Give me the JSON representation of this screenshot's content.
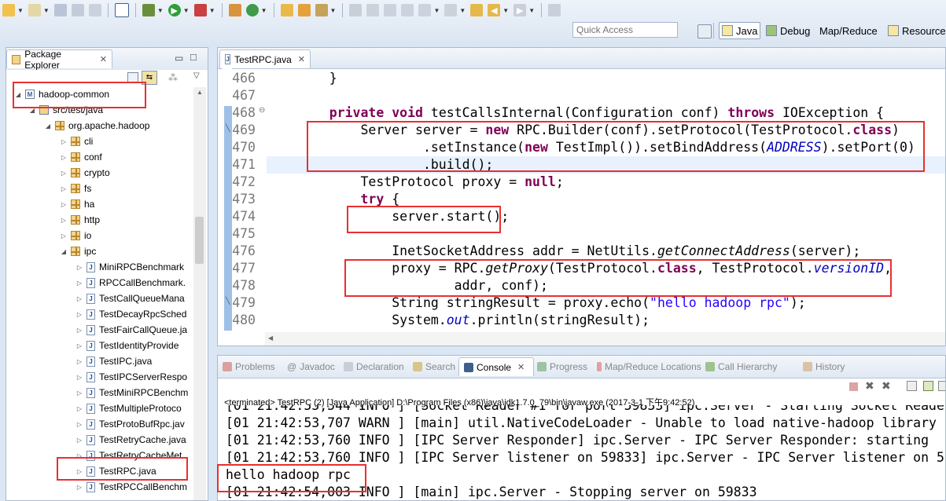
{
  "toolbar": {
    "quick_access_placeholder": "Quick Access",
    "perspectives": [
      "Java",
      "Debug",
      "Map/Reduce",
      "Resource"
    ]
  },
  "package_explorer": {
    "title": "Package Explorer",
    "items": [
      {
        "label": "hadoop-common",
        "indent": 0
      },
      {
        "label": "src/test/java",
        "indent": 1
      },
      {
        "label": "org.apache.hadoop",
        "indent": 2
      },
      {
        "label": "cli",
        "indent": 3
      },
      {
        "label": "conf",
        "indent": 3
      },
      {
        "label": "crypto",
        "indent": 3
      },
      {
        "label": "fs",
        "indent": 3
      },
      {
        "label": "ha",
        "indent": 3
      },
      {
        "label": "http",
        "indent": 3
      },
      {
        "label": "io",
        "indent": 3
      },
      {
        "label": "ipc",
        "indent": 3
      },
      {
        "label": "MiniRPCBenchmark",
        "indent": 4
      },
      {
        "label": "RPCCallBenchmark.",
        "indent": 4
      },
      {
        "label": "TestCallQueueMana",
        "indent": 4
      },
      {
        "label": "TestDecayRpcSched",
        "indent": 4
      },
      {
        "label": "TestFairCallQueue.ja",
        "indent": 4
      },
      {
        "label": "TestIdentityProvide",
        "indent": 4
      },
      {
        "label": "TestIPC.java",
        "indent": 4
      },
      {
        "label": "TestIPCServerRespo",
        "indent": 4
      },
      {
        "label": "TestMiniRPCBenchm",
        "indent": 4
      },
      {
        "label": "TestMultipleProtoco",
        "indent": 4
      },
      {
        "label": "TestProtoBufRpc.jav",
        "indent": 4
      },
      {
        "label": "TestRetryCache.java",
        "indent": 4
      },
      {
        "label": "TestRetryCacheMet",
        "indent": 4
      },
      {
        "label": "TestRPC.java",
        "indent": 4
      },
      {
        "label": "TestRPCCallBenchm",
        "indent": 4
      }
    ]
  },
  "editor": {
    "tab_title": "TestRPC.java",
    "line_numbers": [
      "466",
      "467",
      "468",
      "469",
      "470",
      "471",
      "472",
      "473",
      "474",
      "475",
      "476",
      "477",
      "478",
      "479",
      "480"
    ]
  },
  "bottom_tabs": [
    "Problems",
    "Javadoc",
    "Declaration",
    "Search",
    "Console",
    "Progress",
    "Map/Reduce Locations",
    "Call Hierarchy",
    "History"
  ],
  "console": {
    "status": "<terminated> TestRPC (2) [Java Application] D:\\Program Files (x86)\\java\\jdk1.7.0_79\\bin\\javaw.exe (2017-3-1 下午9:42:52)",
    "lines": [
      "[01 21:42:53,544 INFO ] [Socket Reader #1 for port 59833] ipc.Server - Starting Socket Reade",
      "[01 21:42:53,707 WARN ] [main] util.NativeCodeLoader - Unable to load native-hadoop library",
      "[01 21:42:53,760 INFO ] [IPC Server Responder] ipc.Server - IPC Server Responder: starting",
      "[01 21:42:53,760 INFO ] [IPC Server listener on 59833] ipc.Server - IPC Server listener on 5",
      "hello hadoop rpc",
      "[01 21:42:54,003 INFO ] [main] ipc.Server - Stopping server on 59833"
    ]
  },
  "colors": {
    "keyword": "#7f0055",
    "field": "#0000c0",
    "string": "#2a00ff",
    "highlight": "#e8302f"
  }
}
